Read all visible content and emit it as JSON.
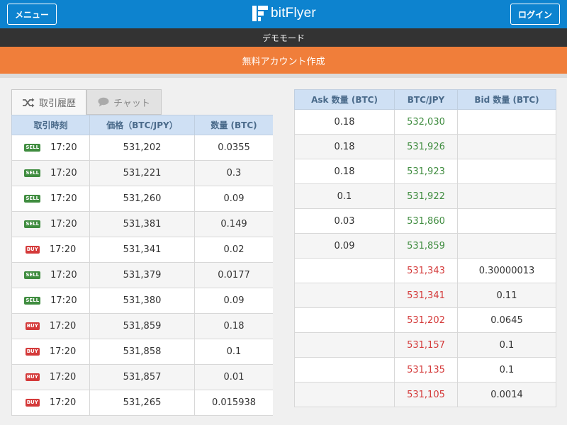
{
  "header": {
    "menu_label": "メニュー",
    "logo_text": "bitFlyer",
    "login_label": "ログイン",
    "bg_color": "#0d83cf"
  },
  "demo_bar": {
    "text": "デモモード"
  },
  "account_bar": {
    "text": "無料アカウント作成",
    "color": "#f07e3a"
  },
  "tabs": {
    "history": {
      "label": "取引履歴",
      "icon": "shuffle-icon"
    },
    "chat": {
      "label": "チャット",
      "icon": "speech-bubble-icon"
    }
  },
  "trade_history": {
    "columns": [
      "取引時刻",
      "価格（BTC/JPY）",
      "数量 (BTC)"
    ],
    "rows": [
      {
        "side": "SELL",
        "time": "17:20",
        "price": "531,202",
        "amount": "0.0355"
      },
      {
        "side": "SELL",
        "time": "17:20",
        "price": "531,221",
        "amount": "0.3"
      },
      {
        "side": "SELL",
        "time": "17:20",
        "price": "531,260",
        "amount": "0.09"
      },
      {
        "side": "SELL",
        "time": "17:20",
        "price": "531,381",
        "amount": "0.149"
      },
      {
        "side": "BUY",
        "time": "17:20",
        "price": "531,341",
        "amount": "0.02"
      },
      {
        "side": "SELL",
        "time": "17:20",
        "price": "531,379",
        "amount": "0.0177"
      },
      {
        "side": "SELL",
        "time": "17:20",
        "price": "531,380",
        "amount": "0.09"
      },
      {
        "side": "BUY",
        "time": "17:20",
        "price": "531,859",
        "amount": "0.18"
      },
      {
        "side": "BUY",
        "time": "17:20",
        "price": "531,858",
        "amount": "0.1"
      },
      {
        "side": "BUY",
        "time": "17:20",
        "price": "531,857",
        "amount": "0.01"
      },
      {
        "side": "BUY",
        "time": "17:20",
        "price": "531,265",
        "amount": "0.015938"
      }
    ]
  },
  "order_book": {
    "columns": [
      "Ask 数量 (BTC)",
      "BTC/JPY",
      "Bid 数量 (BTC)"
    ],
    "asks": [
      {
        "ask": "0.18",
        "price": "532,030",
        "bid": ""
      },
      {
        "ask": "0.18",
        "price": "531,926",
        "bid": ""
      },
      {
        "ask": "0.18",
        "price": "531,923",
        "bid": ""
      },
      {
        "ask": "0.1",
        "price": "531,922",
        "bid": ""
      },
      {
        "ask": "0.03",
        "price": "531,860",
        "bid": ""
      },
      {
        "ask": "0.09",
        "price": "531,859",
        "bid": ""
      }
    ],
    "bids": [
      {
        "ask": "",
        "price": "531,343",
        "bid": "0.30000013"
      },
      {
        "ask": "",
        "price": "531,341",
        "bid": "0.11"
      },
      {
        "ask": "",
        "price": "531,202",
        "bid": "0.0645"
      },
      {
        "ask": "",
        "price": "531,157",
        "bid": "0.1"
      },
      {
        "ask": "",
        "price": "531,135",
        "bid": "0.1"
      },
      {
        "ask": "",
        "price": "531,105",
        "bid": "0.0014"
      }
    ],
    "ask_color": "#3f8c3f",
    "bid_color": "#d43a3a"
  }
}
